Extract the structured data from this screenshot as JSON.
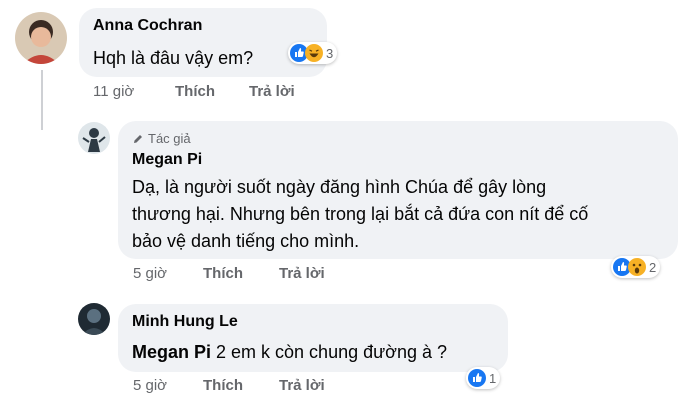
{
  "comments": [
    {
      "author": "Anna Cochran",
      "text": "Hqh là đâu vậy em?",
      "reactions": {
        "icons": [
          "like-icon",
          "haha-icon"
        ],
        "count": "3"
      },
      "actions": {
        "time": "11 giờ",
        "like": "Thích",
        "reply": "Trả lời"
      }
    },
    {
      "badge": "Tác giả",
      "author": "Megan Pi",
      "text_lines": [
        "Dạ, là người suốt ngày đăng hình Chúa để gây lòng",
        "thương hại. Nhưng bên trong lại bắt cả đứa con nít để cố",
        "bảo vệ danh tiếng cho mình."
      ],
      "reactions": {
        "icons": [
          "like-icon",
          "wow-icon"
        ],
        "count": "2"
      },
      "actions": {
        "time": "5 giờ",
        "like": "Thích",
        "reply": "Trả lời"
      }
    },
    {
      "author": "Minh Hung Le",
      "mention": "Megan Pi",
      "text": " 2 em k còn chung đường à ?",
      "reactions": {
        "icons": [
          "like-icon"
        ],
        "count": "1"
      },
      "actions": {
        "time": "5 giờ",
        "like": "Thích",
        "reply": "Trả lời"
      }
    }
  ],
  "colors": {
    "bubble": "#f0f2f5",
    "secondary_text": "#65676b",
    "like_blue": "#1877f2",
    "emoji_yellow": "#f7b125"
  }
}
